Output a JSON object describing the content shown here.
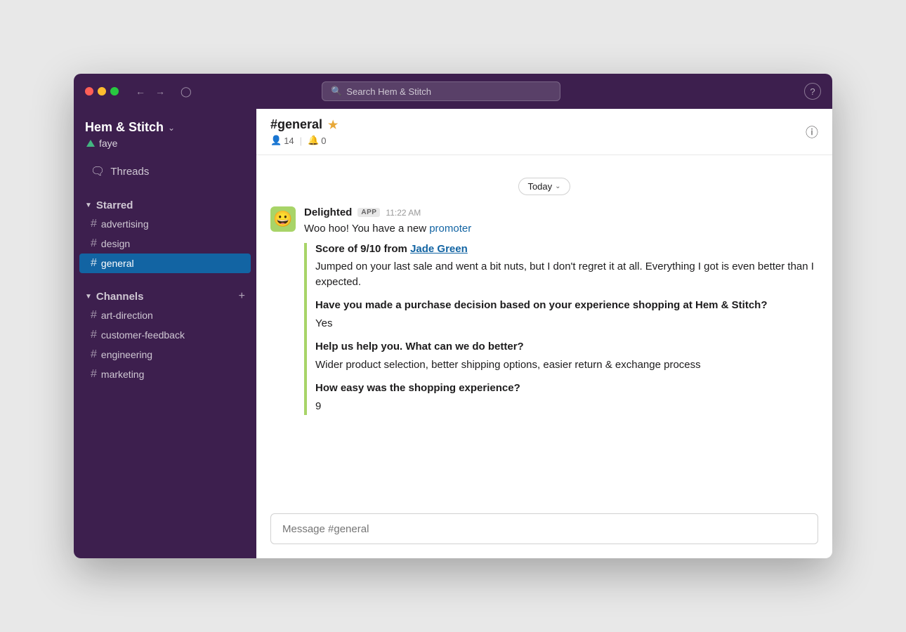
{
  "window": {
    "titlebar": {
      "search_placeholder": "Search Hem & Stitch",
      "help_label": "?"
    }
  },
  "sidebar": {
    "workspace_name": "Hem & Stitch",
    "user_name": "faye",
    "threads_label": "Threads",
    "starred_label": "Starred",
    "starred_channels": [
      {
        "name": "advertising"
      },
      {
        "name": "design"
      },
      {
        "name": "general"
      }
    ],
    "channels_label": "Channels",
    "channels": [
      {
        "name": "art-direction"
      },
      {
        "name": "customer-feedback"
      },
      {
        "name": "engineering"
      },
      {
        "name": "marketing"
      }
    ]
  },
  "chat": {
    "channel_name": "#general",
    "member_count": "14",
    "notification_count": "0",
    "date_label": "Today",
    "message": {
      "sender": "Delighted",
      "app_badge": "APP",
      "timestamp": "11:22 AM",
      "intro_text": "Woo hoo! You have a new",
      "intro_link": "promoter",
      "card": {
        "score_label": "Score of 9/10 from",
        "score_link": "Jade Green",
        "body": "Jumped on your last sale and went a bit nuts, but I don't regret it at all. Everything I got is even better than I expected.",
        "q1": "Have you made a purchase decision based on your experience shopping at Hem & Stitch?",
        "a1": "Yes",
        "q2": "Help us help you. What can we do better?",
        "a2": "Wider product selection, better shipping options, easier return & exchange process",
        "q3": "How easy was the shopping experience?",
        "a3": "9"
      }
    },
    "input_placeholder": "Message #general"
  }
}
